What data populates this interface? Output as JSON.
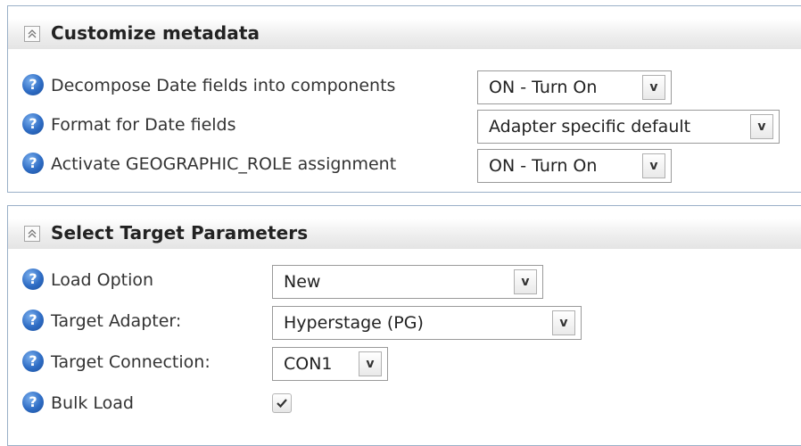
{
  "metadata_section": {
    "title": "Customize metadata",
    "rows": [
      {
        "label": "Decompose Date fields into components",
        "value": "ON - Turn On"
      },
      {
        "label": "Format for Date fields",
        "value": "Adapter specific default"
      },
      {
        "label": "Activate GEOGRAPHIC_ROLE assignment",
        "value": "ON - Turn On"
      }
    ]
  },
  "target_section": {
    "title": "Select Target Parameters",
    "rows": [
      {
        "label": "Load Option",
        "value": "New"
      },
      {
        "label": "Target Adapter:",
        "value": "Hyperstage (PG)"
      },
      {
        "label": "Target Connection:",
        "value": "CON1"
      },
      {
        "label": "Bulk Load",
        "checked": true
      }
    ]
  },
  "icons": {
    "help": "question-circle-icon",
    "collapse": "chevron-up-double-icon",
    "dropdown": "chevron-down-icon",
    "check": "checkmark-icon"
  },
  "glyphs": {
    "help": "?",
    "dropdown_arrow": "v"
  },
  "colors": {
    "help_icon": "#2e6cc4",
    "border": "#9ab0c8"
  }
}
